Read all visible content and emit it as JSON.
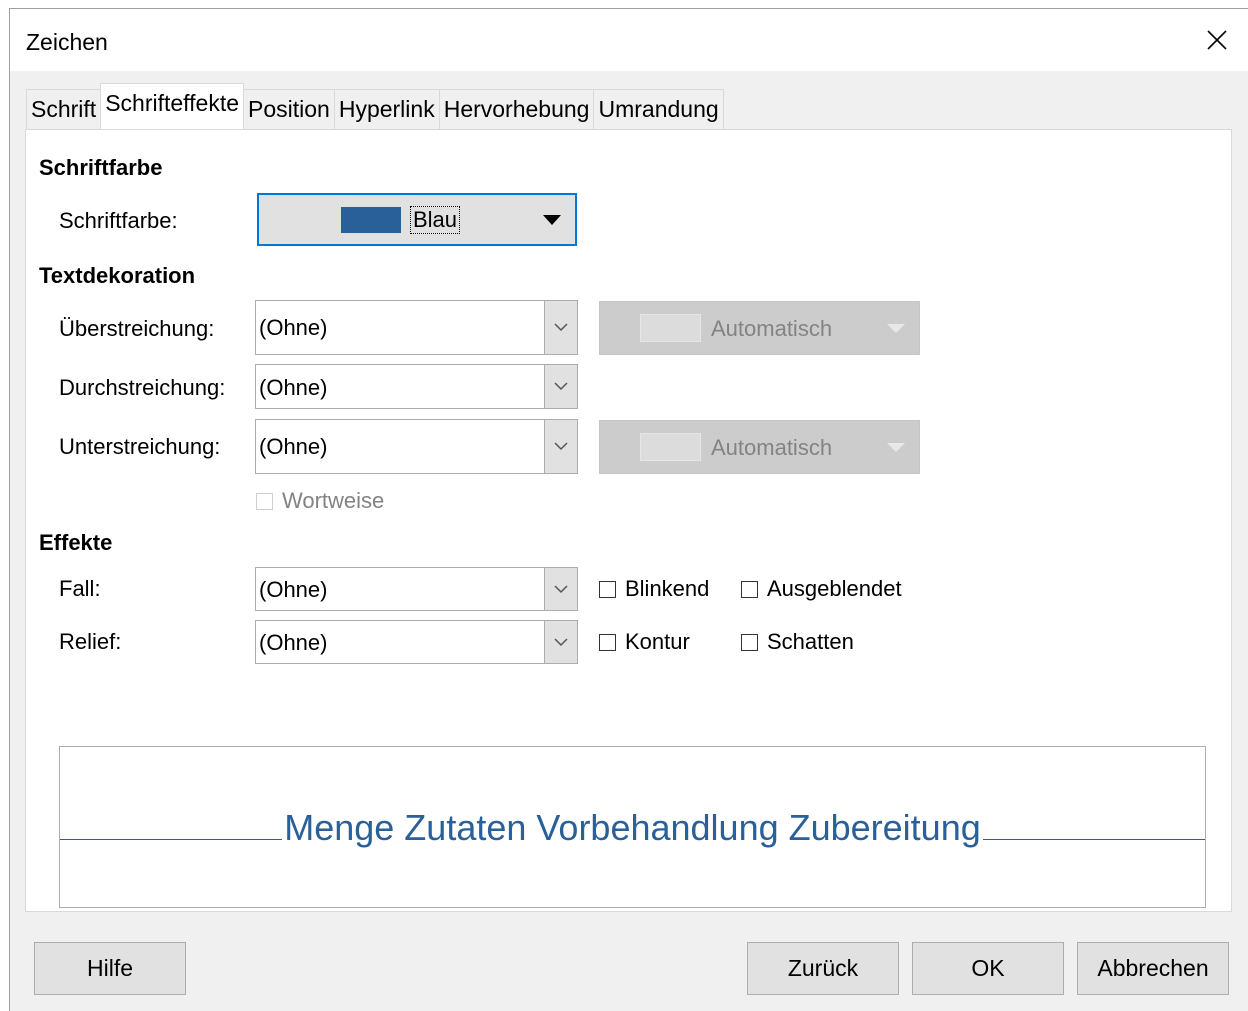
{
  "window": {
    "title": "Zeichen"
  },
  "tabs": [
    {
      "label": "Schrift",
      "active": false
    },
    {
      "label": "Schrifteffekte",
      "active": true
    },
    {
      "label": "Position",
      "active": false
    },
    {
      "label": "Hyperlink",
      "active": false
    },
    {
      "label": "Hervorhebung",
      "active": false
    },
    {
      "label": "Umrandung",
      "active": false
    }
  ],
  "font_color": {
    "section_title": "Schriftfarbe",
    "label": "Schriftfarbe:",
    "value": "Blau",
    "swatch_color": "#2a6099",
    "icon": "dropdown-arrow-icon"
  },
  "text_decoration": {
    "section_title": "Textdekoration",
    "overline": {
      "label": "Überstreichung:",
      "value": "(Ohne)",
      "color_value": "Automatisch"
    },
    "strikethrough": {
      "label": "Durchstreichung:",
      "value": "(Ohne)"
    },
    "underline": {
      "label": "Unterstreichung:",
      "value": "(Ohne)",
      "color_value": "Automatisch"
    },
    "word_by_word": {
      "label": "Wortweise",
      "checked": false,
      "enabled": false
    }
  },
  "effects": {
    "section_title": "Effekte",
    "case": {
      "label": "Fall:",
      "value": "(Ohne)"
    },
    "relief": {
      "label": "Relief:",
      "value": "(Ohne)"
    },
    "blinking": {
      "label": "Blinkend",
      "checked": false
    },
    "hidden": {
      "label": "Ausgeblendet",
      "checked": false
    },
    "outline": {
      "label": "Kontur",
      "checked": false
    },
    "shadow": {
      "label": "Schatten",
      "checked": false
    }
  },
  "preview": {
    "text": "Menge Zutaten Vorbehandlung Zubereitung",
    "color": "#2a6099"
  },
  "buttons": {
    "help": "Hilfe",
    "reset": "Zurück",
    "ok": "OK",
    "cancel": "Abbrechen"
  }
}
